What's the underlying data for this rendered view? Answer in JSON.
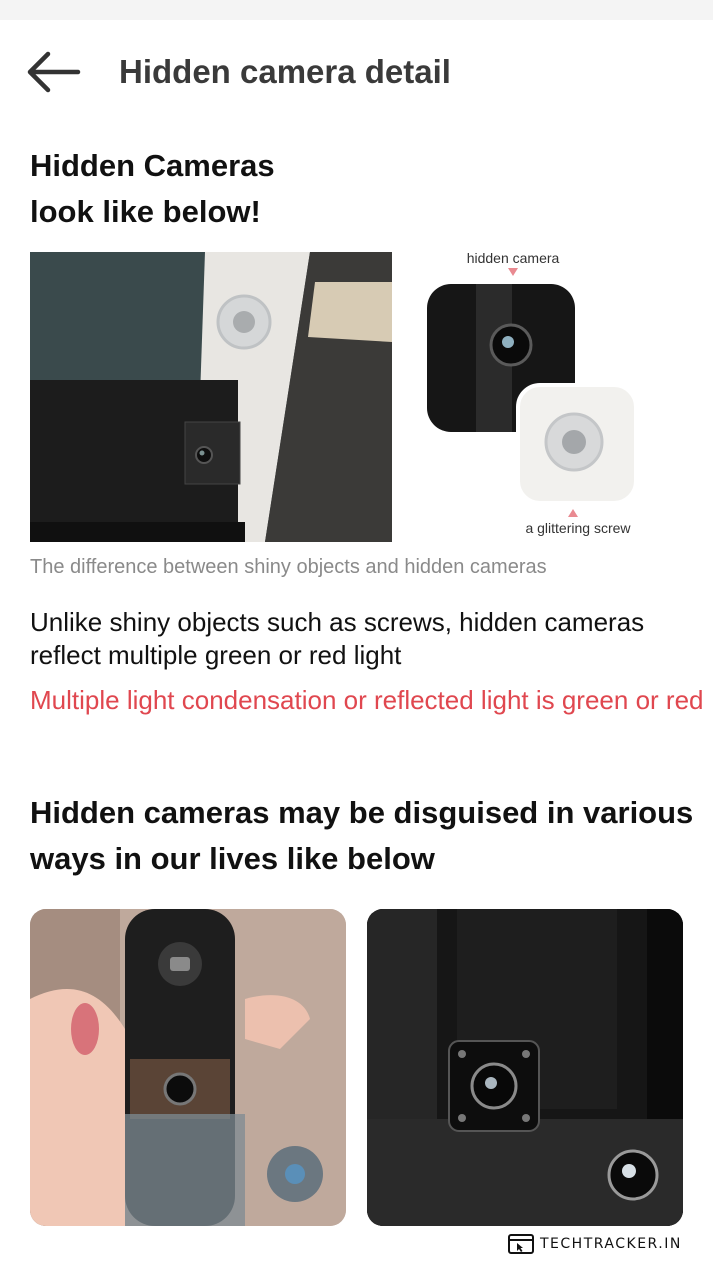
{
  "header": {
    "title": "Hidden camera detail",
    "back_icon": "arrow-left-icon"
  },
  "intro": {
    "heading_line1": "Hidden Cameras",
    "heading_line2": "look like below!",
    "diagram_label_top": "hidden camera",
    "diagram_label_bottom": "a glittering screw",
    "caption": "The difference between shiny objects and hidden cameras",
    "body": "Unlike shiny objects such as screws, hidden cameras reflect multiple green or red light",
    "warning": "Multiple light condensation or reflected light is green or red"
  },
  "disguise": {
    "heading": "Hidden cameras may be disguised in various ways in our lives like below"
  },
  "watermark": {
    "text": "TECHTRACKER.IN"
  },
  "colors": {
    "warning": "#e0474f",
    "caption": "#8a8a8a",
    "title": "#3a3a3a",
    "marker": "#e98a91"
  }
}
